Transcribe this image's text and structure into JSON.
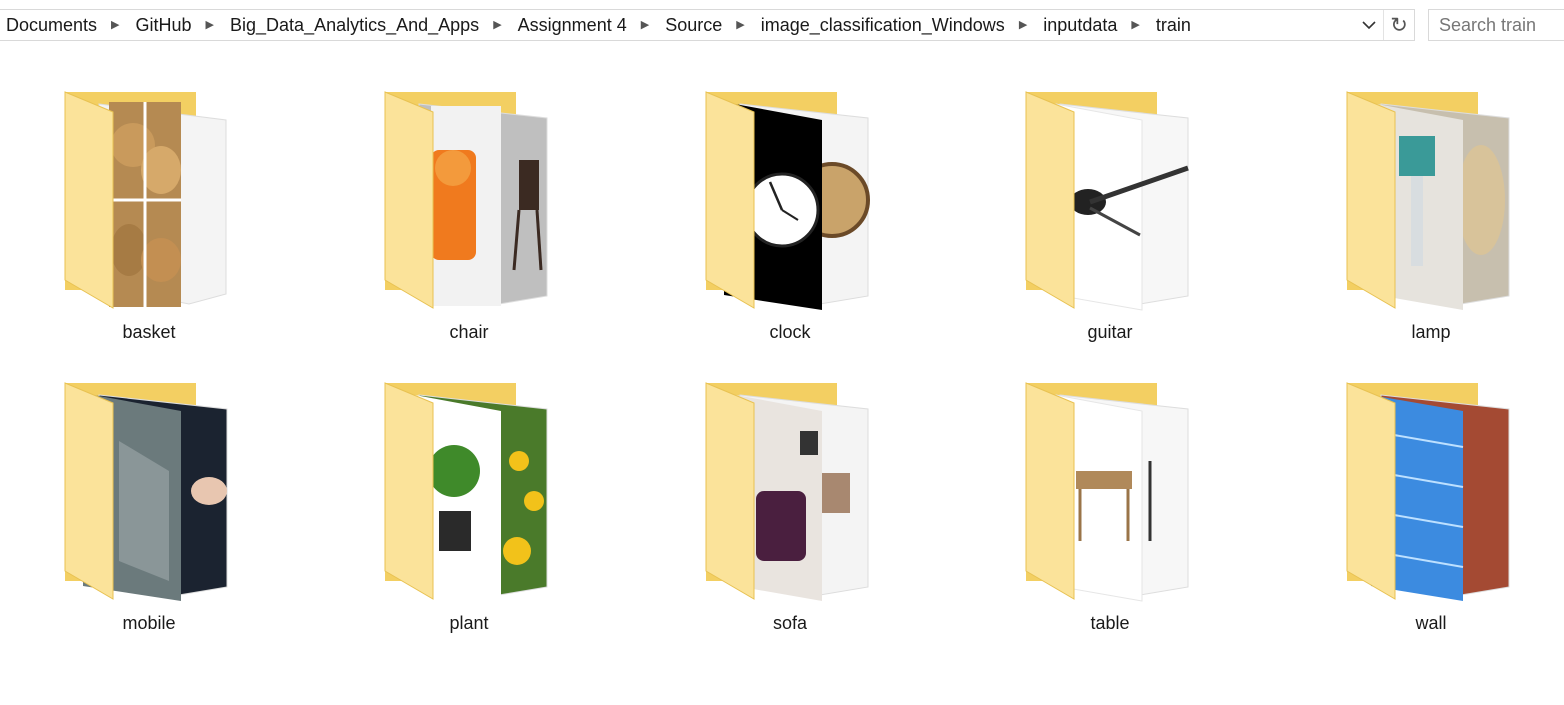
{
  "breadcrumb": [
    "Documents",
    "GitHub",
    "Big_Data_Analytics_And_Apps",
    "Assignment 4",
    "Source",
    "image_classification_Windows",
    "inputdata",
    "train"
  ],
  "search": {
    "placeholder": "Search train"
  },
  "folders": [
    {
      "label": "basket",
      "icon": "folder-icon",
      "preview": "baskets"
    },
    {
      "label": "chair",
      "icon": "folder-icon",
      "preview": "chairs"
    },
    {
      "label": "clock",
      "icon": "folder-icon",
      "preview": "clocks"
    },
    {
      "label": "guitar",
      "icon": "folder-icon",
      "preview": "guitars"
    },
    {
      "label": "lamp",
      "icon": "folder-icon",
      "preview": "lamps"
    },
    {
      "label": "mobile",
      "icon": "folder-icon",
      "preview": "phones"
    },
    {
      "label": "plant",
      "icon": "folder-icon",
      "preview": "plants"
    },
    {
      "label": "sofa",
      "icon": "folder-icon",
      "preview": "sofas"
    },
    {
      "label": "table",
      "icon": "folder-icon",
      "preview": "tables"
    },
    {
      "label": "wall",
      "icon": "folder-icon",
      "preview": "brick walls"
    }
  ],
  "colors": {
    "folder_back": "#f5d66e",
    "folder_front": "#fbe6a0",
    "folder_edge": "#e8c252"
  }
}
